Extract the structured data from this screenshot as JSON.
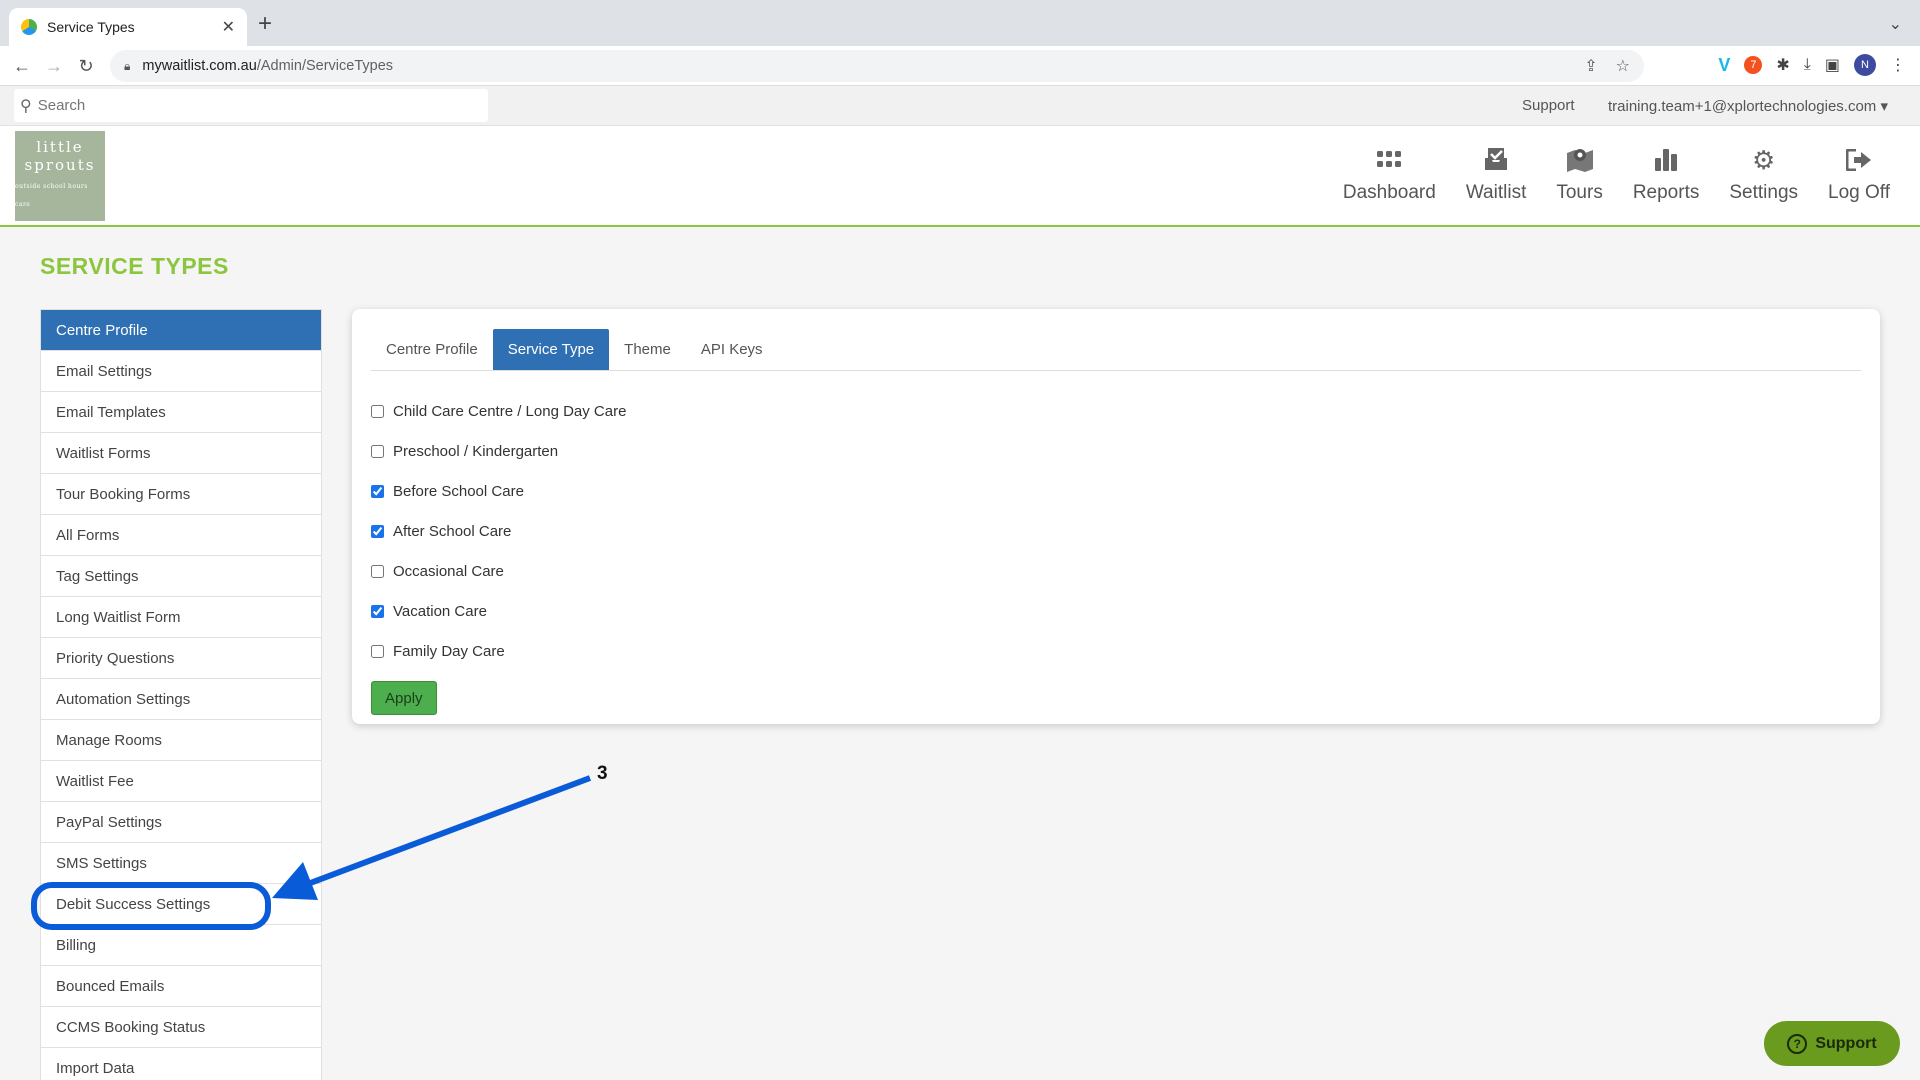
{
  "browser": {
    "tab_title": "Service Types",
    "url_host": "mywaitlist.com.au",
    "url_path": "/Admin/ServiceTypes",
    "profile_initial": "N"
  },
  "topbar": {
    "search_placeholder": "Search",
    "support_label": "Support",
    "user_label": "training.team+1@xplortechnologies.com ▾"
  },
  "logo": {
    "line1": "little",
    "line2": "sprouts",
    "tagline": "outside school hours care",
    "color": "#a6b69c"
  },
  "nav": [
    {
      "label": "Dashboard",
      "icon": "grid-icon"
    },
    {
      "label": "Waitlist",
      "icon": "inbox-check-icon"
    },
    {
      "label": "Tours",
      "icon": "map-pin-icon"
    },
    {
      "label": "Reports",
      "icon": "bar-chart-icon"
    },
    {
      "label": "Settings",
      "icon": "gear-icon"
    },
    {
      "label": "Log Off",
      "icon": "sign-out-icon"
    }
  ],
  "page": {
    "title": "SERVICE TYPES",
    "title_color": "#8cc63f"
  },
  "sidebar": {
    "accent_color": "#2f6fb3",
    "items": [
      {
        "label": "Centre Profile"
      },
      {
        "label": "Email Settings"
      },
      {
        "label": "Email Templates"
      },
      {
        "label": "Waitlist Forms"
      },
      {
        "label": "Tour Booking Forms"
      },
      {
        "label": "All Forms"
      },
      {
        "label": "Tag Settings"
      },
      {
        "label": "Long Waitlist Form"
      },
      {
        "label": "Priority Questions"
      },
      {
        "label": "Automation Settings"
      },
      {
        "label": "Manage Rooms"
      },
      {
        "label": "Waitlist Fee"
      },
      {
        "label": "PayPal Settings"
      },
      {
        "label": "SMS Settings"
      },
      {
        "label": "Debit Success Settings"
      },
      {
        "label": "Billing"
      },
      {
        "label": "Bounced Emails"
      },
      {
        "label": "CCMS Booking Status"
      },
      {
        "label": "Import Data"
      }
    ]
  },
  "panel": {
    "tabs": [
      {
        "label": "Centre Profile"
      },
      {
        "label": "Service Type"
      },
      {
        "label": "Theme"
      },
      {
        "label": "API Keys"
      }
    ],
    "service_types": [
      {
        "label": "Child Care Centre / Long Day Care",
        "checked": false
      },
      {
        "label": "Preschool / Kindergarten",
        "checked": false
      },
      {
        "label": "Before School Care",
        "checked": true
      },
      {
        "label": "After School Care",
        "checked": true
      },
      {
        "label": "Occasional Care",
        "checked": false
      },
      {
        "label": "Vacation Care",
        "checked": true
      },
      {
        "label": "Family Day Care",
        "checked": false
      }
    ],
    "apply_label": "Apply"
  },
  "annotation": {
    "step_number": "3",
    "color": "#0a5bd8"
  },
  "support_widget": {
    "label": "Support",
    "color": "#6a9a1e"
  }
}
